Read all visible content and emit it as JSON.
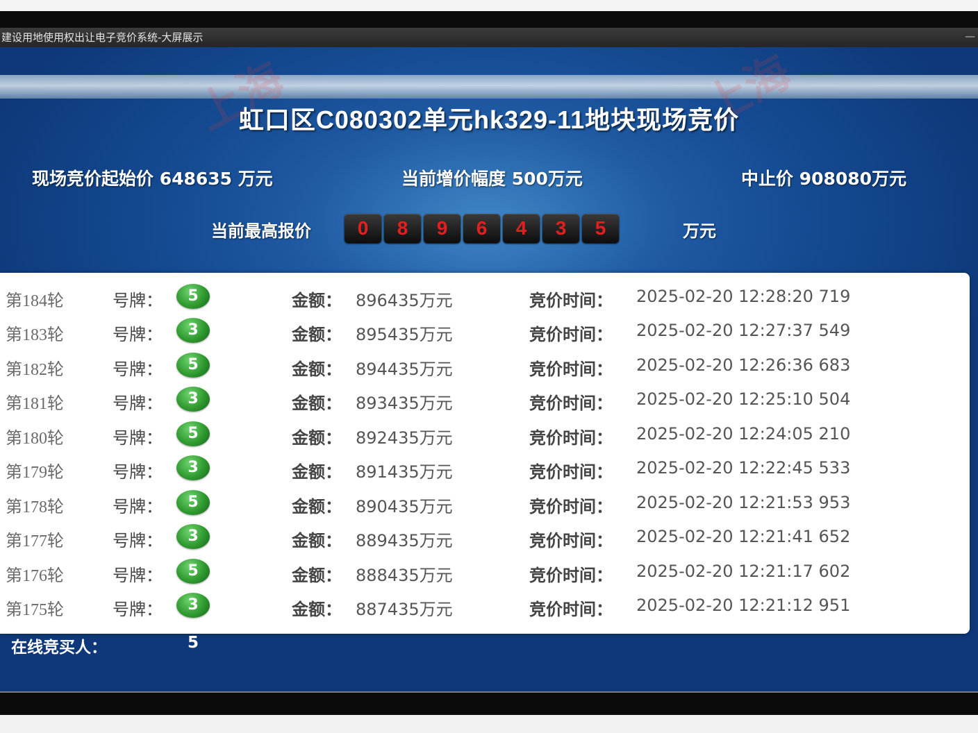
{
  "window": {
    "title": "建设用地使用权出让电子竞价系统-大屏展示",
    "minimize_glyph": "—"
  },
  "header": {
    "title": "虹口区C080302单元hk329-11地块现场竞价"
  },
  "info": {
    "start_price": "现场竞价起始价 648635 万元",
    "increment": "当前增价幅度 500万元",
    "stop_price": "中止价 908080万元"
  },
  "highest_bid": {
    "label": "当前最高报价",
    "digits": [
      "0",
      "8",
      "9",
      "6",
      "4",
      "3",
      "5"
    ],
    "unit": "万元",
    "digit_color": "#e41f1f"
  },
  "labels": {
    "plate": "号牌：",
    "amount": "金额：",
    "time": "竞价时间："
  },
  "bids": [
    {
      "round": "第184轮",
      "plate": "5",
      "amount": "896435万元",
      "time": "2025-02-20 12:28:20 719"
    },
    {
      "round": "第183轮",
      "plate": "3",
      "amount": "895435万元",
      "time": "2025-02-20 12:27:37 549"
    },
    {
      "round": "第182轮",
      "plate": "5",
      "amount": "894435万元",
      "time": "2025-02-20 12:26:36 683"
    },
    {
      "round": "第181轮",
      "plate": "3",
      "amount": "893435万元",
      "time": "2025-02-20 12:25:10 504"
    },
    {
      "round": "第180轮",
      "plate": "5",
      "amount": "892435万元",
      "time": "2025-02-20 12:24:05 210"
    },
    {
      "round": "第179轮",
      "plate": "3",
      "amount": "891435万元",
      "time": "2025-02-20 12:22:45 533"
    },
    {
      "round": "第178轮",
      "plate": "5",
      "amount": "890435万元",
      "time": "2025-02-20 12:21:53 953"
    },
    {
      "round": "第177轮",
      "plate": "3",
      "amount": "889435万元",
      "time": "2025-02-20 12:21:41 652"
    },
    {
      "round": "第176轮",
      "plate": "5",
      "amount": "888435万元",
      "time": "2025-02-20 12:21:17 602"
    },
    {
      "round": "第175轮",
      "plate": "3",
      "amount": "887435万元",
      "time": "2025-02-20 12:21:12 951"
    }
  ],
  "online": {
    "label": "在线竞买人：",
    "count": "5"
  },
  "watermark": {
    "text": "上海"
  },
  "colors": {
    "badge_green": "#2f9a2f",
    "screen_blue": "#1f5aa3"
  }
}
